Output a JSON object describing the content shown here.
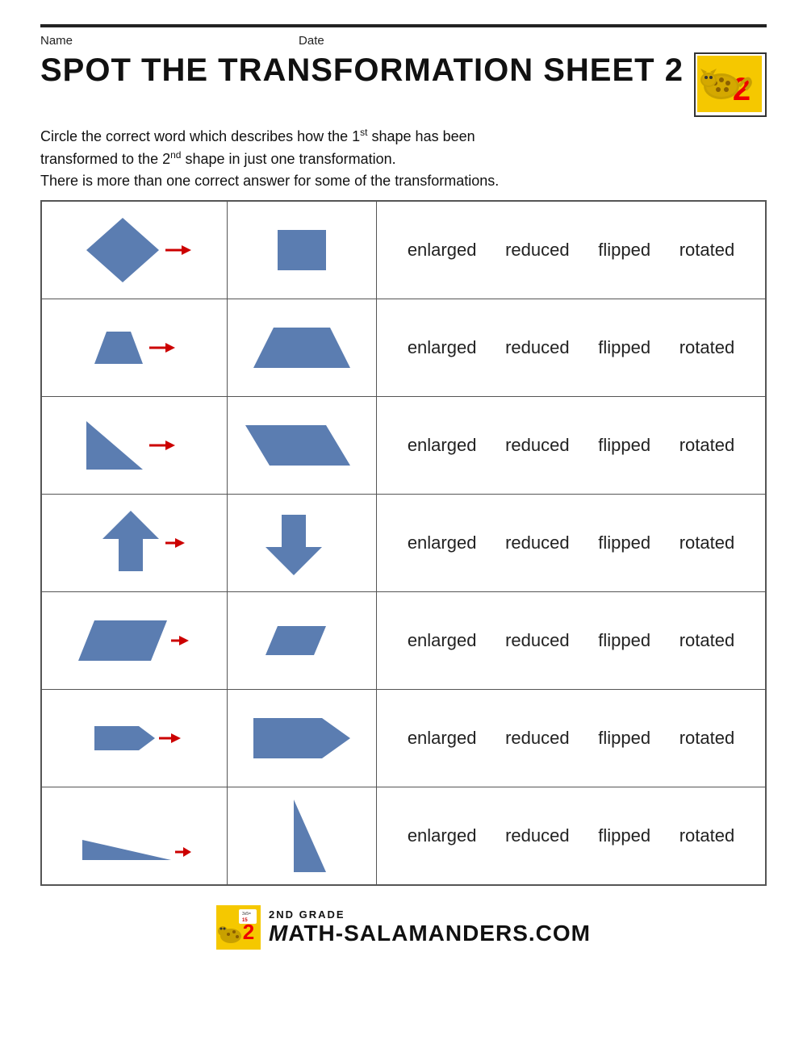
{
  "header": {
    "name_label": "Name",
    "date_label": "Date",
    "title": "SPOT THE TRANSFORMATION SHEET 2"
  },
  "instructions": {
    "line1": "Circle the correct word which describes how the 1",
    "sup1": "st",
    "line1b": " shape has been",
    "line2": "transformed to the 2",
    "sup2": "nd",
    "line2b": " shape in just one transformation.",
    "line3": "There is more than one correct answer for some of the transformations."
  },
  "words": [
    "enlarged",
    "reduced",
    "flipped",
    "rotated"
  ],
  "rows": [
    {
      "id": 1,
      "shape_left": "diamond",
      "shape_right": "square"
    },
    {
      "id": 2,
      "shape_left": "trapezoid",
      "shape_right": "trapezoid_larger"
    },
    {
      "id": 3,
      "shape_left": "right_triangle_left",
      "shape_right": "parallelogram_right"
    },
    {
      "id": 4,
      "shape_left": "arrow_up",
      "shape_right": "arrow_down"
    },
    {
      "id": 5,
      "shape_left": "parallelogram_large",
      "shape_right": "parallelogram_small"
    },
    {
      "id": 6,
      "shape_left": "arrow_right_small",
      "shape_right": "arrow_right_large"
    },
    {
      "id": 7,
      "shape_left": "right_triangle_flat",
      "shape_right": "triangle_tall"
    }
  ],
  "footer": {
    "grade": "2ND GRADE",
    "brand": "MATH-SALAMANDERS.COM"
  }
}
